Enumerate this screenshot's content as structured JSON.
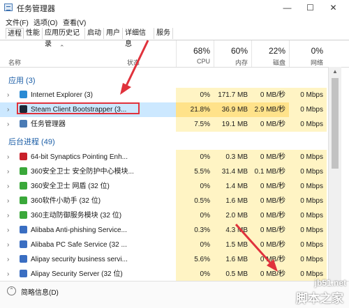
{
  "window": {
    "title": "任务管理器",
    "minimize": "—",
    "maximize": "☐",
    "close": "✕"
  },
  "menu": [
    "文件(F)",
    "选项(O)",
    "查看(V)"
  ],
  "tabs": [
    "进程",
    "性能",
    "应用历史记录",
    "启动",
    "用户",
    "详细信息",
    "服务"
  ],
  "header": {
    "name_label": "名称",
    "status_label": "状态",
    "columns": [
      {
        "pct": "68%",
        "name": "CPU"
      },
      {
        "pct": "60%",
        "name": "内存"
      },
      {
        "pct": "22%",
        "name": "磁盘"
      },
      {
        "pct": "0%",
        "name": "网络"
      }
    ]
  },
  "groups": {
    "apps": "应用 (3)",
    "background": "后台进程 (49)"
  },
  "apps": [
    {
      "name": "Internet Explorer (3)",
      "cpu": "0%",
      "mem": "171.7 MB",
      "disk": "0 MB/秒",
      "net": "0 Mbps",
      "icon": "ie-icon",
      "color": "#2a8ad4"
    },
    {
      "name": "Steam Client Bootstrapper (3...",
      "cpu": "21.8%",
      "mem": "36.9 MB",
      "disk": "2.9 MB/秒",
      "net": "0 Mbps",
      "icon": "steam-icon",
      "color": "#1b2838"
    },
    {
      "name": "任务管理器",
      "cpu": "7.5%",
      "mem": "19.1 MB",
      "disk": "0 MB/秒",
      "net": "0 Mbps",
      "icon": "task-manager-icon",
      "color": "#4a7bb5"
    }
  ],
  "background": [
    {
      "name": "64-bit Synaptics Pointing Enh...",
      "cpu": "0%",
      "mem": "0.3 MB",
      "disk": "0 MB/秒",
      "net": "0 Mbps",
      "icon": "synaptics-icon",
      "color": "#c8202a"
    },
    {
      "name": "360安全卫士 安全防护中心模块...",
      "cpu": "5.5%",
      "mem": "31.4 MB",
      "disk": "0.1 MB/秒",
      "net": "0 Mbps",
      "icon": "360-icon",
      "color": "#3aa83a"
    },
    {
      "name": "360安全卫士 网盾 (32 位)",
      "cpu": "0%",
      "mem": "1.4 MB",
      "disk": "0 MB/秒",
      "net": "0 Mbps",
      "icon": "360-icon",
      "color": "#3aa83a"
    },
    {
      "name": "360软件小助手 (32 位)",
      "cpu": "0.5%",
      "mem": "1.6 MB",
      "disk": "0 MB/秒",
      "net": "0 Mbps",
      "icon": "360-helper-icon",
      "color": "#3aa83a"
    },
    {
      "name": "360主动防御服务模块 (32 位)",
      "cpu": "0%",
      "mem": "2.0 MB",
      "disk": "0 MB/秒",
      "net": "0 Mbps",
      "icon": "360-icon",
      "color": "#3aa83a"
    },
    {
      "name": "Alibaba Anti-phishing Service...",
      "cpu": "0.3%",
      "mem": "4.3 MB",
      "disk": "0 MB/秒",
      "net": "0 Mbps",
      "icon": "alibaba-icon",
      "color": "#3a6ec2"
    },
    {
      "name": "Alibaba PC Safe Service (32 ...",
      "cpu": "0%",
      "mem": "1.5 MB",
      "disk": "0 MB/秒",
      "net": "0 Mbps",
      "icon": "alibaba-icon",
      "color": "#3a6ec2"
    },
    {
      "name": "Alipay security business servi...",
      "cpu": "5.6%",
      "mem": "1.6 MB",
      "disk": "0 MB/秒",
      "net": "0 Mbps",
      "icon": "alipay-icon",
      "color": "#3a6ec2"
    },
    {
      "name": "Alipay Security Server (32 位)",
      "cpu": "0%",
      "mem": "0.5 MB",
      "disk": "0 MB/秒",
      "net": "0 Mbps",
      "icon": "alipay-icon",
      "color": "#3a6ec2"
    }
  ],
  "footer": {
    "label": "简略信息(D)"
  },
  "watermark": {
    "site": "jb51.net",
    "name": "脚本之家"
  },
  "colors": {
    "selected_row": "#cce8ff",
    "highlight": "#e0323c",
    "heat": "#fff4c4",
    "accent": "#1a5da6"
  }
}
